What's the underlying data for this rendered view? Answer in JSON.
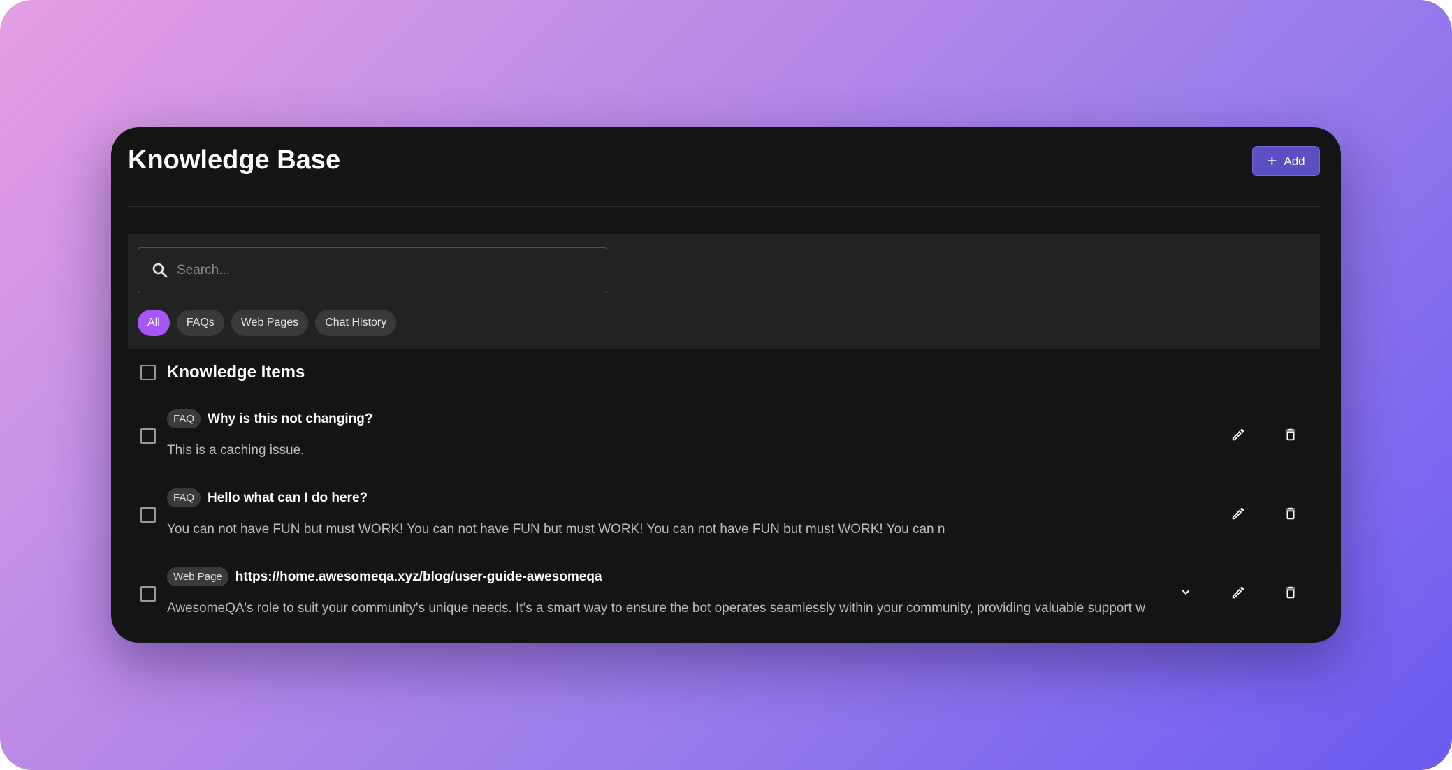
{
  "page": {
    "title": "Knowledge Base",
    "add_label": "Add"
  },
  "search": {
    "placeholder": "Search...",
    "value": ""
  },
  "filters": [
    {
      "label": "All",
      "active": true
    },
    {
      "label": "FAQs",
      "active": false
    },
    {
      "label": "Web Pages",
      "active": false
    },
    {
      "label": "Chat History",
      "active": false
    }
  ],
  "list": {
    "header": "Knowledge Items",
    "items": [
      {
        "type": "FAQ",
        "title": "Why is this not changing?",
        "body": "This is a caching issue.",
        "expandable": false
      },
      {
        "type": "FAQ",
        "title": "Hello what can I do here?",
        "body": "You can not have FUN but must WORK! You can not have FUN but must WORK! You can not have FUN but must WORK! You can n",
        "expandable": false
      },
      {
        "type": "Web Page",
        "title": "https://home.awesomeqa.xyz/blog/user-guide-awesomeqa",
        "body": "AwesomeQA's role to suit your community's unique needs. It's a smart way to ensure the bot operates seamlessly within your community, providing valuable support w",
        "expandable": true
      }
    ]
  },
  "icons": {
    "search": "search-icon",
    "plus": "plus-icon",
    "edit": "pencil-icon",
    "delete": "trash-icon",
    "expand": "chevron-down-icon"
  },
  "colors": {
    "accent": "#5b4fc4",
    "active_chip": "#a855f7",
    "window_bg": "#141414",
    "panel_bg": "#222222"
  }
}
